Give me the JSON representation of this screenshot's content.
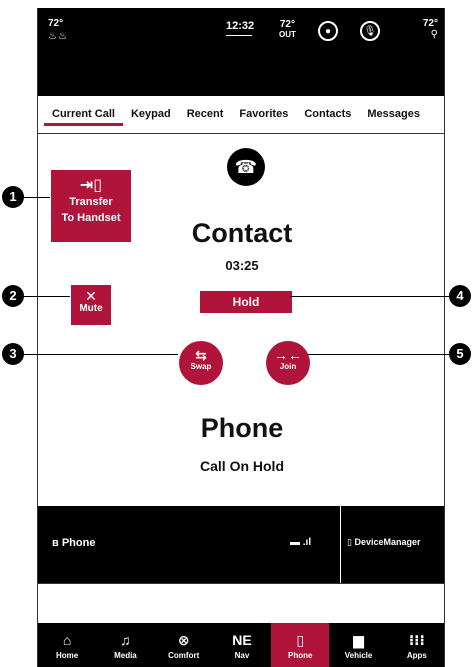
{
  "status_bar": {
    "left_temp": "72°",
    "clock": "12:32",
    "outside_temp": "72°",
    "outside_label": "OUT",
    "right_temp": "72°"
  },
  "tabs": [
    {
      "label": "Current Call",
      "active": true
    },
    {
      "label": "Keypad"
    },
    {
      "label": "Recent"
    },
    {
      "label": "Favorites"
    },
    {
      "label": "Contacts"
    },
    {
      "label": "Messages"
    }
  ],
  "call": {
    "transfer_label_1": "Transfer",
    "transfer_label_2": "To Handset",
    "mute_label": "Mute",
    "contact_name": "Contact",
    "timer": "03:25",
    "hold_label": "Hold",
    "swap_label": "Swap",
    "join_label": "Join",
    "held_name": "Phone",
    "held_status": "Call On Hold"
  },
  "device_row": {
    "phone_label": "Phone",
    "device_manager_label": "DeviceManager"
  },
  "bottom_nav": [
    {
      "label": "Home",
      "icon": "home-icon"
    },
    {
      "label": "Media",
      "icon": "music-note-icon"
    },
    {
      "label": "Comfort",
      "icon": "comfort-icon"
    },
    {
      "label": "Nav",
      "icon": "compass-icon",
      "heading": "NE"
    },
    {
      "label": "Phone",
      "icon": "phone-icon",
      "active": true
    },
    {
      "label": "Vehicle",
      "icon": "car-icon"
    },
    {
      "label": "Apps",
      "icon": "apps-grid-icon"
    }
  ],
  "callouts": [
    "1",
    "2",
    "3",
    "4",
    "5"
  ],
  "colors": {
    "accent": "#b0143a",
    "bar_background": "#000000"
  }
}
